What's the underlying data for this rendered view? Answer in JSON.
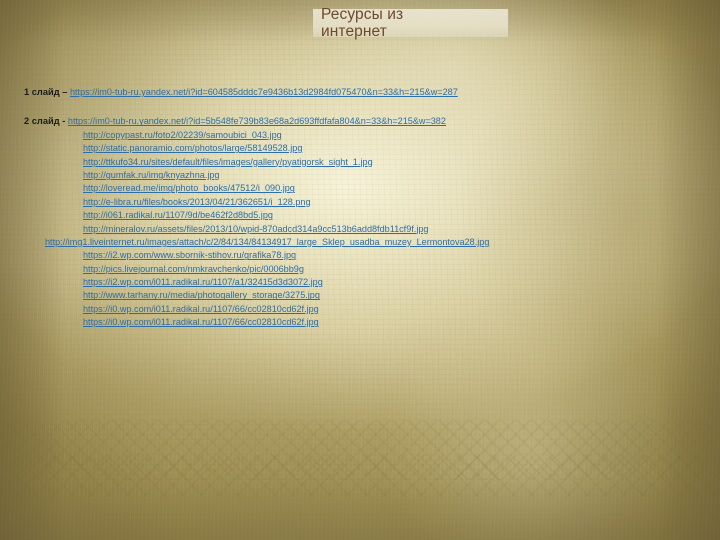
{
  "slide": {
    "title": "Ресурсы из интернет",
    "title_line1": "Ресурсы из",
    "title_line2": "интернет",
    "background_color": "#cdc49b",
    "link_color": "#2c6ea8",
    "title_color": "#6d4a2f"
  },
  "entries": [
    {
      "label": "1 слайд – ",
      "url": "https://im0-tub-ru.yandex.net/i?id=604585dddc7e9436b13d2984fd075470&n=33&h=215&w=287",
      "indent": "none",
      "gap_above": false
    },
    {
      "label": "2 слайд - ",
      "url": "https://im0-tub-ru.yandex.net/i?id=5b548fe739b83e68a2d693ffdfafa804&n=33&h=215&w=382",
      "indent": "none",
      "gap_above": true
    },
    {
      "label": "",
      "url": "http://copypast.ru/foto2/02239/samoubici_043.jpg",
      "indent": "large",
      "gap_above": false
    },
    {
      "label": "",
      "url": "http://static.panoramio.com/photos/large/58149528.jpg",
      "indent": "large",
      "gap_above": false
    },
    {
      "label": "",
      "url": "http://ttkufo34.ru/sites/default/files/images/gallery/pyatigorsk_sight_1.jpg",
      "indent": "large",
      "gap_above": false
    },
    {
      "label": "",
      "url": "http://gumfak.ru/img/knyazhna.jpg",
      "indent": "large",
      "gap_above": false
    },
    {
      "label": "",
      "url": "http://loveread.me/img/photo_books/47512/i_090.jpg",
      "indent": "large",
      "gap_above": false
    },
    {
      "label": "",
      "url": "http://e-libra.ru/files/books/2013/04/21/362651/i_128.png",
      "indent": "large",
      "gap_above": false
    },
    {
      "label": "",
      "url": "http://i061.radikal.ru/1107/9d/be462f2d8bd5.jpg",
      "indent": "large",
      "gap_above": false
    },
    {
      "label": "",
      "url": "http://mineralov.ru/assets/files/2013/10/wpid-870adcd314a9cc513b6add8fdb11cf9f.jpg",
      "indent": "large",
      "gap_above": false
    },
    {
      "label": "",
      "url": "http://img1.liveinternet.ru/images/attach/c/2/84/134/84134917_large_Sklep_usadba_muzey_Lermontova28.jpg",
      "indent": "small",
      "gap_above": false
    },
    {
      "label": "",
      "url": "https://i2.wp.com/www.sbornik-stihov.ru/grafika78.jpg",
      "indent": "large",
      "gap_above": false
    },
    {
      "label": "",
      "url": "http://pics.livejournal.com/nmkravchenko/pic/0006bb9g",
      "indent": "large",
      "gap_above": false
    },
    {
      "label": "",
      "url": "https://i2.wp.com/i011.radikal.ru/1107/a1/32415d3d3072.jpg",
      "indent": "large",
      "gap_above": false
    },
    {
      "label": "",
      "url": "http://www.tarhany.ru/media/photogallery_storage/3275.jpg",
      "indent": "large",
      "gap_above": false
    },
    {
      "label": "",
      "url": "https://i0.wp.com/i011.radikal.ru/1107/66/cc02810cd62f.jpg",
      "indent": "large",
      "gap_above": false
    },
    {
      "label": "",
      "url": "https://i0.wp.com/i011.radikal.ru/1107/66/cc02810cd62f.jpg",
      "indent": "large",
      "gap_above": false
    }
  ]
}
